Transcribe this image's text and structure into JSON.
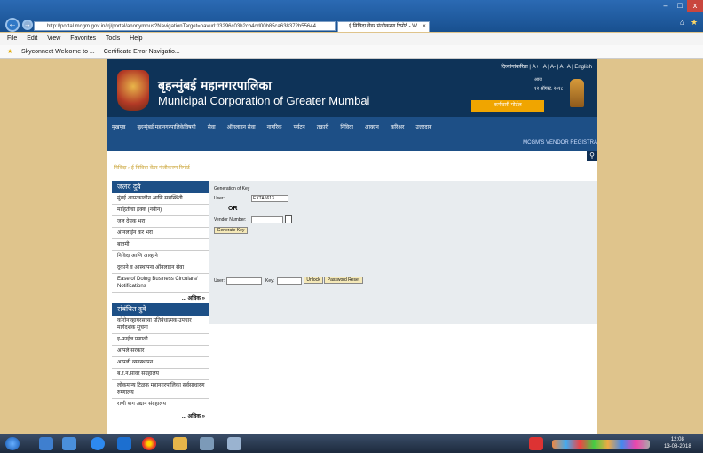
{
  "browser": {
    "url": "http://portal.mcgm.gov.in/irj/portal/anonymous?NavigationTarget=navurl://3296c03b2cb4cd00b85ca638372b55644",
    "tab_title": "ई निविदा वेंडर पंजीकरण रिपोर्ट - W...",
    "close": "×",
    "menu": [
      "File",
      "Edit",
      "View",
      "Favorites",
      "Tools",
      "Help"
    ],
    "favorites": [
      "Skyconnect Welcome to ...",
      "Certificate Error Navigatio..."
    ],
    "window_buttons": [
      "–",
      "□",
      "x"
    ]
  },
  "header": {
    "languages": "दिव्यांगांकरिता | A+ | A | A- | A | A | English",
    "org_hindi": "बृहन्मुंबई महानगरपालिका",
    "org_english": "Municipal Corporation of Greater Mumbai",
    "date_label": "आज",
    "date": "१२ ऑगस्ट, २०१८",
    "latest_button": "कर्मचारी पोर्टल"
  },
  "nav": {
    "items": [
      "मुखपृष्ठ",
      "बृहन्मुंबई महानगरपालिकेविषयी",
      "सेवा",
      "ऑनलाइन सेवा",
      "नागरिक",
      "पर्यटन",
      "तक्रारी",
      "निविदा",
      "आव्हान",
      "करिअर",
      "उत्तरदान"
    ]
  },
  "strip_text": "MCGM'S VENDOR REGISTRA",
  "search_icon": "magnifier",
  "breadcrumb": "निविदा › ई निविदा वेंडर पंजीकरण रिपोर्ट",
  "sidebar": {
    "heading1": "जलद दुवे",
    "links1": [
      "मुंबई आपत्कालीन आणि सद्यस्थिती",
      "माहितीचा हक्क (नवीन)",
      "जल देयक भरा",
      "ऑनलाईन कर भरा",
      "बातमी",
      "निविदा आणि आव्हाने",
      "दुकाने व आस्थापना ऑनलाइन सेवा",
      "Ease of Doing Business Circulars/ Notifications"
    ],
    "more": "... अधिक »",
    "heading2": "संबंधित दुवे",
    "links2": [
      "कोरोनाव्हायरसच्या प्रतिबंधात्मक उपचार मार्गदर्शक सूचना",
      "इ-फाईल प्रणाली",
      "आपले सरकार",
      "आपली व्यवस्थापन",
      "ब.र.न.सावर संग्रहालय",
      "लोकमान्य टिळक महानगरपालिका सर्वसाधारण रुग्णालय",
      "राणी बाग उद्यान संग्रहालय"
    ]
  },
  "form": {
    "generation_label": "Generation of Key",
    "user_label": "User:",
    "user_value": "EXTA5613",
    "or_label": "OR",
    "vendor_label": "Vendor Number:",
    "vendor_value": "",
    "generate_button": "Generate Key",
    "user2_label": "User:",
    "key_label": "Key:",
    "unlock_button": "Unlock",
    "reset_button": "Password Reset"
  },
  "taskbar": {
    "time": "12:08",
    "date": "13-08-2018"
  }
}
